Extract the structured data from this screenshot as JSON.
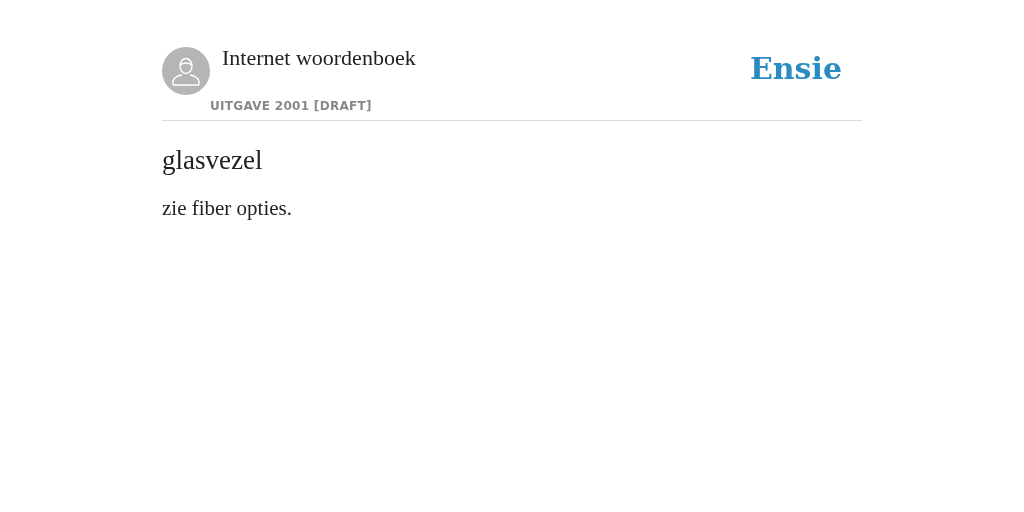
{
  "header": {
    "title": "Internet woordenboek",
    "edition": "UITGAVE 2001 [DRAFT]",
    "logo": "Ensie"
  },
  "entry": {
    "term": "glasvezel",
    "definition": "zie fiber opties."
  }
}
